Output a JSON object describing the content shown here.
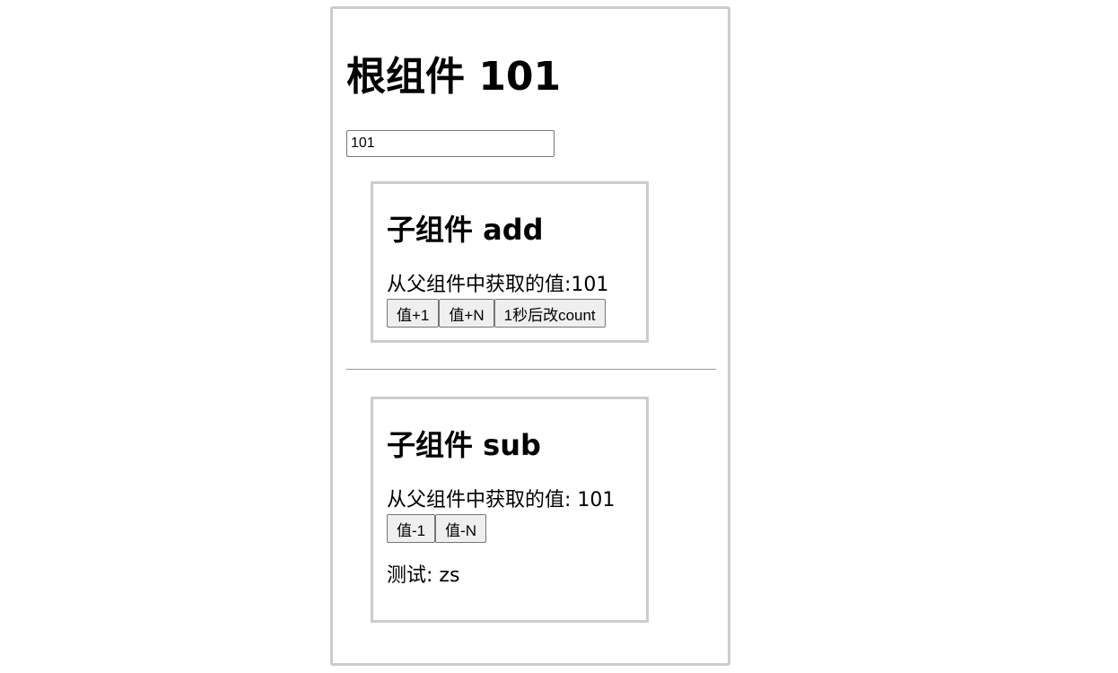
{
  "root": {
    "title": "根组件 101",
    "input_value": "101"
  },
  "child_add": {
    "title": "子组件 add",
    "value_text": "从父组件中获取的值:101",
    "buttons": [
      "值+1",
      "值+N",
      "1秒后改count"
    ]
  },
  "child_sub": {
    "title": "子组件 sub",
    "value_text": "从父组件中获取的值: 101",
    "buttons": [
      "值-1",
      "值-N"
    ],
    "test_text": "测试: zs"
  },
  "colors": {
    "border": "#cccccc",
    "button_bg": "#efefef",
    "divider": "#999999"
  }
}
